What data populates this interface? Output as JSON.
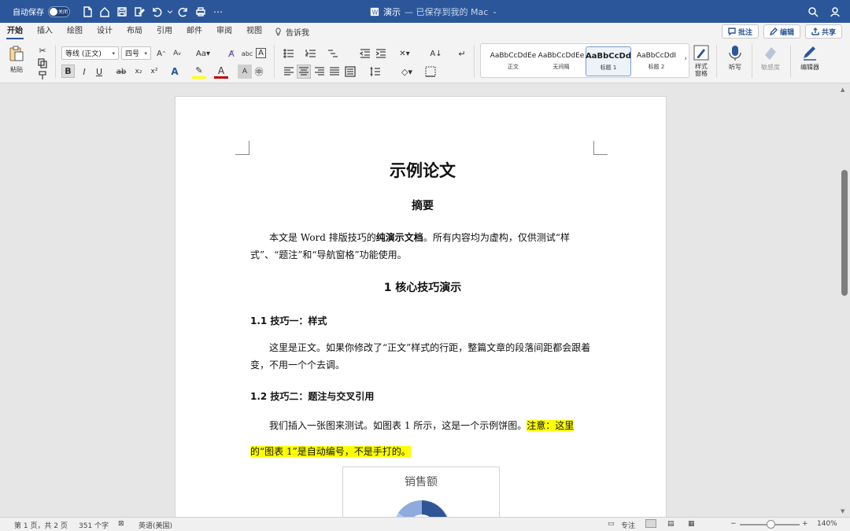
{
  "titlebar": {
    "autosave_label": "自动保存",
    "autosave_state": "关闭",
    "doc_name": "演示",
    "save_status": "— 已保存到我的 Mac"
  },
  "tabs": [
    "开始",
    "插入",
    "绘图",
    "设计",
    "布局",
    "引用",
    "邮件",
    "审阅",
    "视图"
  ],
  "tell_me": "告诉我",
  "actions": {
    "comment": "批注",
    "edit": "编辑",
    "share": "共享"
  },
  "ribbon": {
    "paste": "粘贴",
    "font_name": "等线 (正文)",
    "font_size": "四号",
    "bold": "B",
    "italic": "I",
    "underline": "U",
    "strike": "ab",
    "subscript": "x₂",
    "superscript": "x²",
    "styles": [
      {
        "sample": "AaBbCcDdEe",
        "name": "正文"
      },
      {
        "sample": "AaBbCcDdEe",
        "name": "无间隔"
      },
      {
        "sample": "AaBbCcDd",
        "name": "标题 1"
      },
      {
        "sample": "AaBbCcDdI",
        "name": "标题 2"
      }
    ],
    "styles_pane": "样式\n窗格",
    "dictate": "听写",
    "sensitivity": "敏感度",
    "editor": "编辑器"
  },
  "document": {
    "title": "示例论文",
    "abstract_heading": "摘要",
    "abstract_a": "本文是 Word 排版技巧的",
    "abstract_bold": "纯演示文档",
    "abstract_b": "。所有内容均为虚构，仅供测试“样式”、“题注”和“导航窗格”功能使用。",
    "h1": "1  核心技巧演示",
    "h2_1": "1.1  技巧一：样式",
    "para_1": "这里是正文。如果你修改了“正文”样式的行距，整篇文章的段落间距都会跟着变，不用一个个去调。",
    "h2_2": "1.2  技巧二：题注与交叉引用",
    "para_2_plain": "我们插入一张图来测试。如图表 1 所示，这是一个示例饼图。",
    "para_2_hl_a": "注意：这里的",
    "para_2_hl_b": "“图表 1”是自动编号，不是手打的。",
    "chart_title": "销售额"
  },
  "status": {
    "page": "第 1 页，共 2 页",
    "words": "351 个字",
    "language": "英语(美国)",
    "focus": "专注",
    "zoom": "140%"
  }
}
